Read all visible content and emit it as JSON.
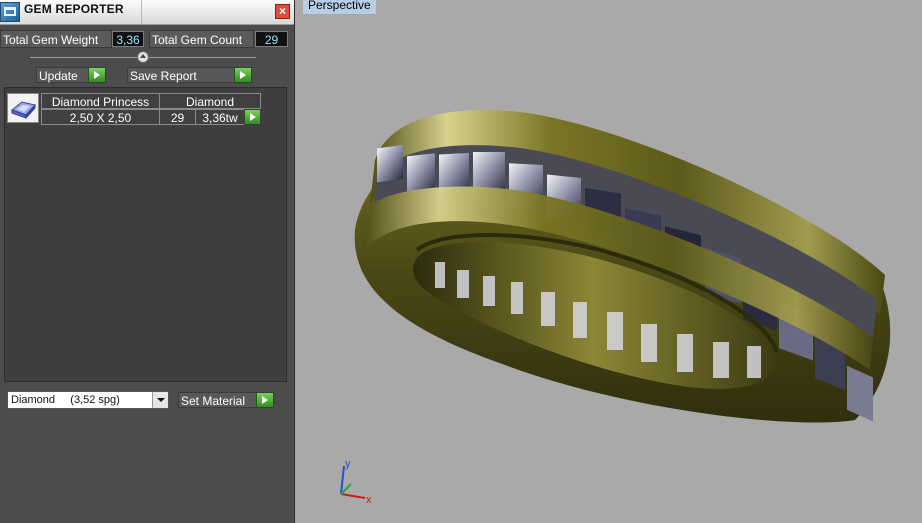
{
  "panel": {
    "title": "GEM REPORTER",
    "close_glyph": "×",
    "total_weight_label": "Total Gem Weight",
    "total_weight_value": "3,36",
    "total_count_label": "Total Gem Count",
    "total_count_value": "29",
    "update_label": "Update",
    "save_report_label": "Save Report",
    "gem_row": {
      "name": "Diamond Princess",
      "material": "Diamond",
      "size": "2,50 X 2,50",
      "count": "29",
      "weight": "3,36tw"
    },
    "material_select_value": "Diamond     (3,52 spg)",
    "set_material_label": "Set Material"
  },
  "viewport": {
    "label": "Perspective",
    "axis_y": "y",
    "axis_x": "x"
  },
  "colors": {
    "panel_bg": "#4c4c4c",
    "viewport_bg": "#a9a9a9",
    "accent_green": "#3fa52a",
    "ring_gold": "#6b6a1f"
  }
}
